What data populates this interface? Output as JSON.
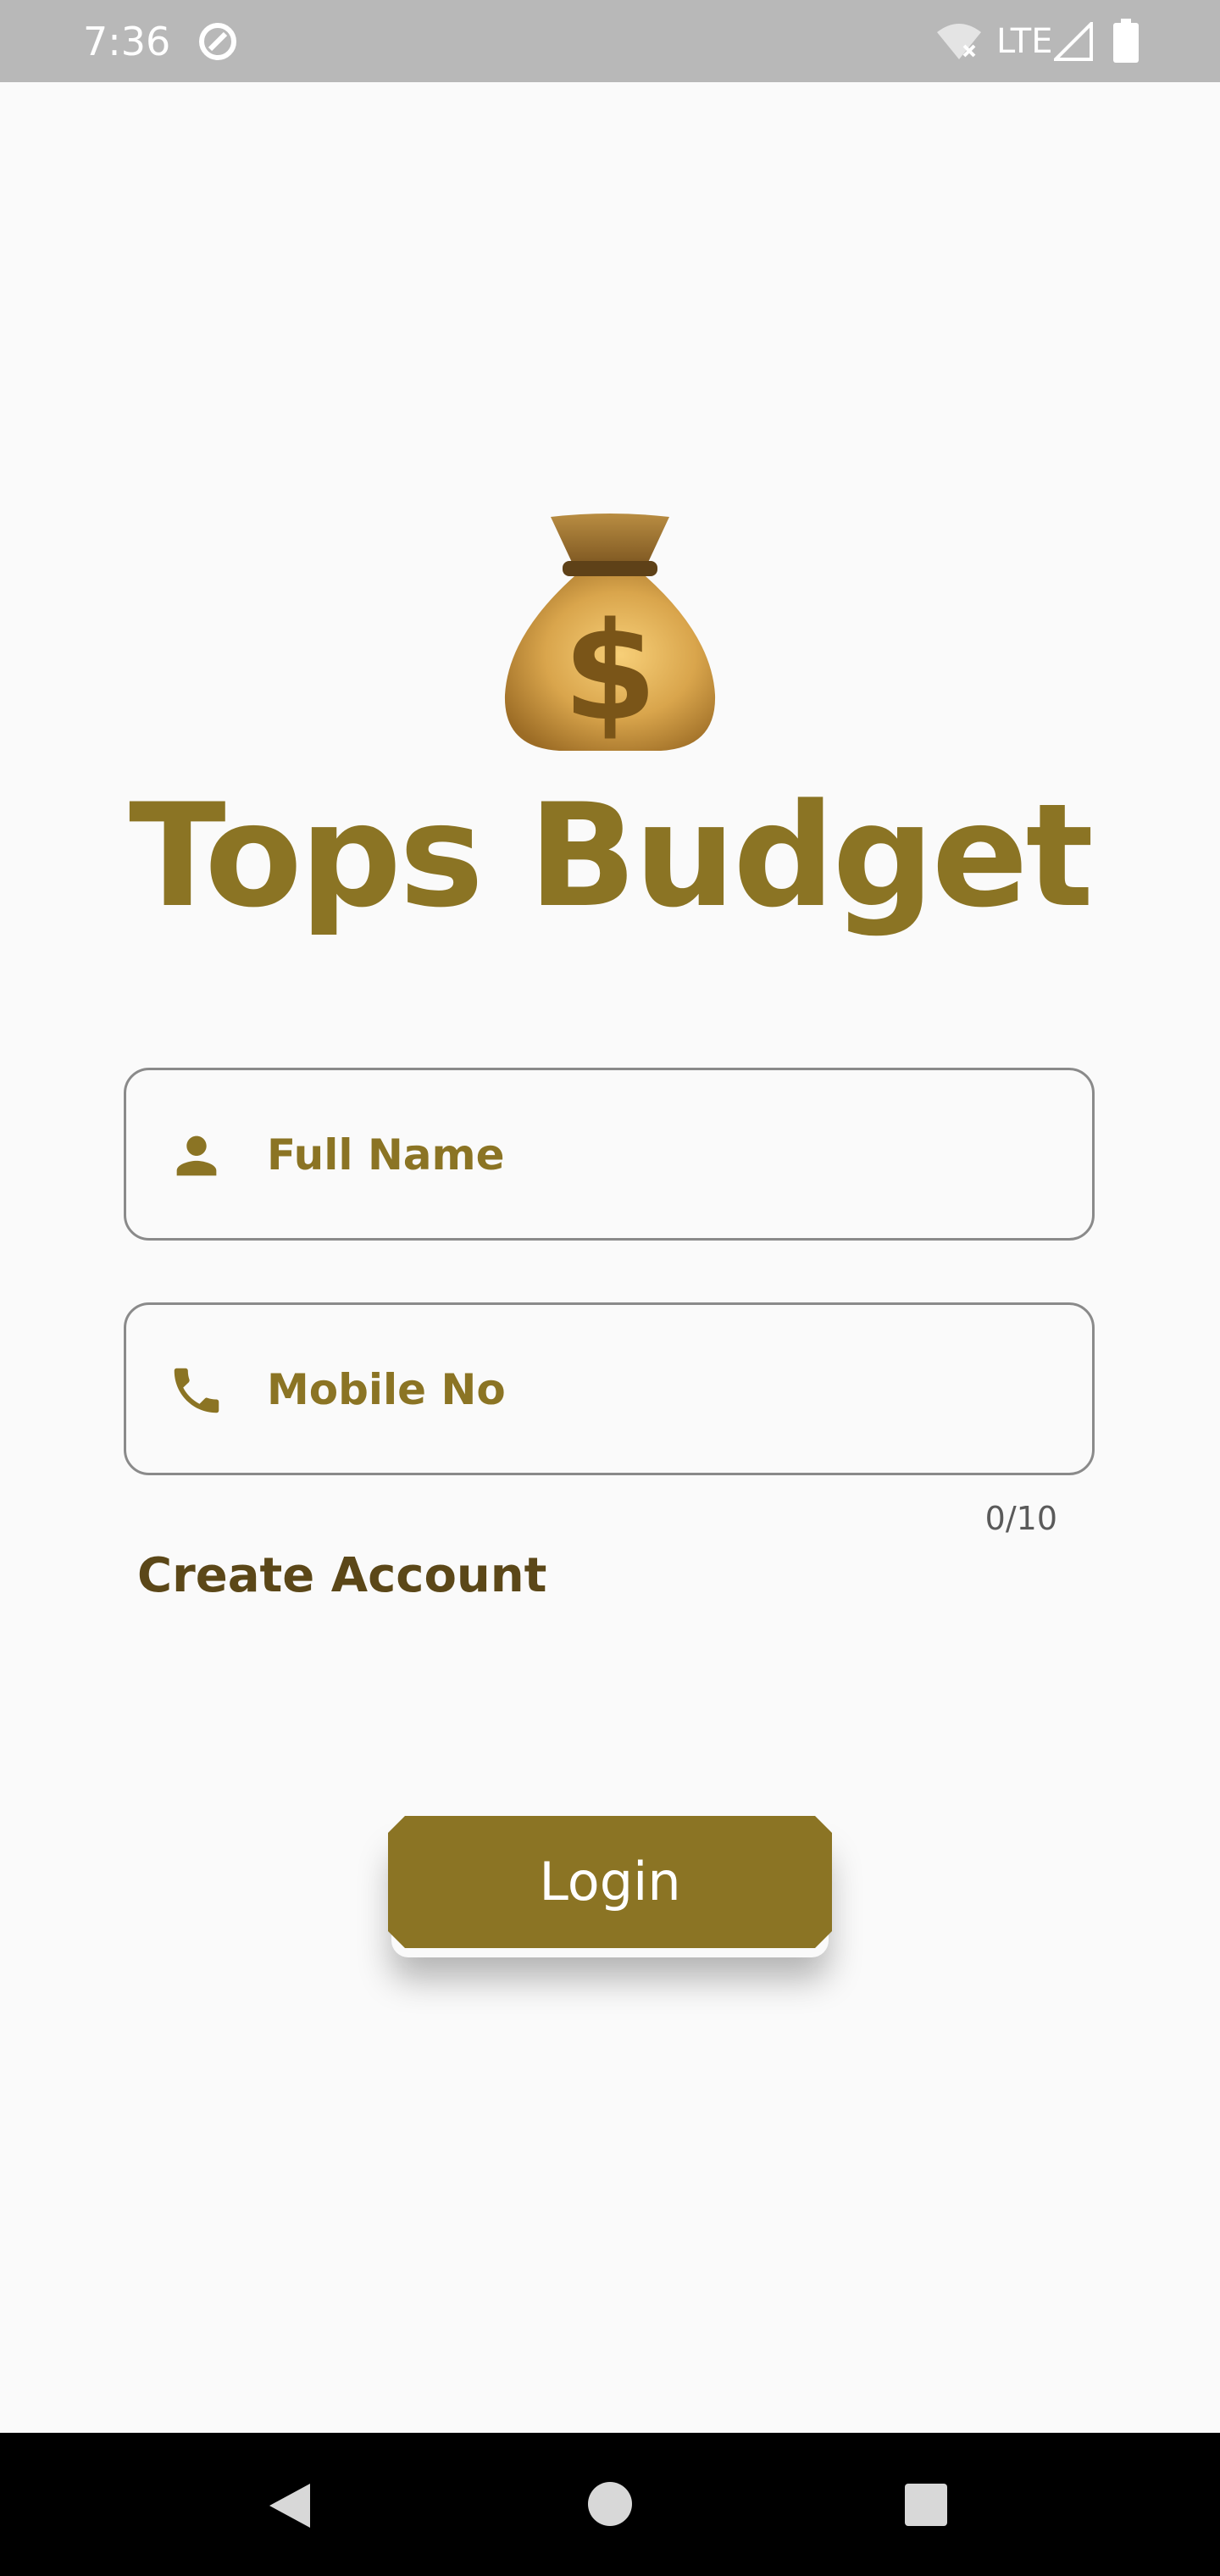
{
  "status_bar": {
    "time": "7:36",
    "network": "LTE",
    "icons": [
      "app-notification-icon",
      "wifi-off-icon",
      "signal-icon",
      "battery-icon"
    ]
  },
  "app": {
    "logo_icon": "money-bag-icon",
    "title": "Tops Budget"
  },
  "form": {
    "full_name": {
      "icon": "person-icon",
      "placeholder": "Full Name",
      "value": ""
    },
    "mobile": {
      "icon": "phone-icon",
      "placeholder": "Mobile No",
      "value": "",
      "counter": "0/10"
    },
    "create_account_label": "Create Account",
    "login_label": "Login"
  },
  "nav_bar": {
    "icons": [
      "back-icon",
      "home-icon",
      "recents-icon"
    ]
  },
  "colors": {
    "accent": "#8b7424",
    "link": "#5b4718",
    "status_bar": "#b8b8b8",
    "background": "#fafafa"
  }
}
